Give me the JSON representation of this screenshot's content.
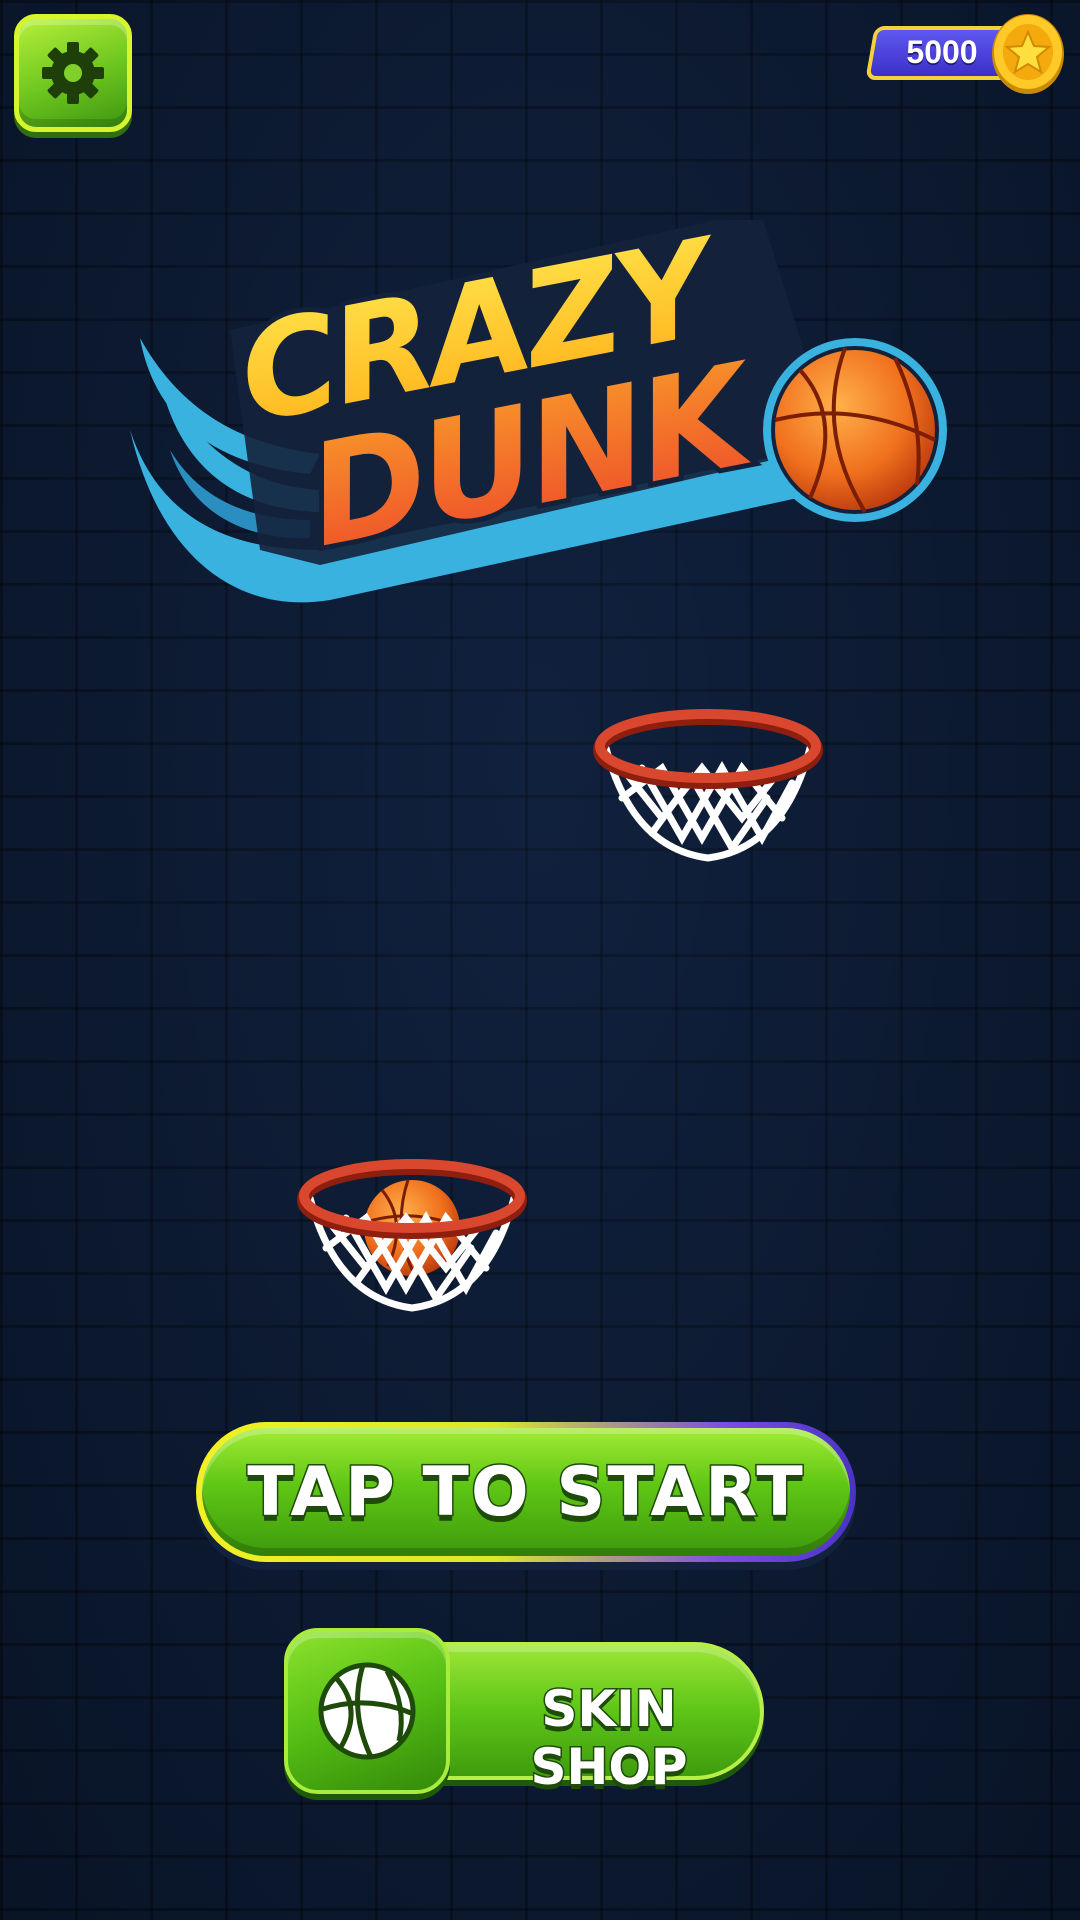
{
  "top_bar": {
    "settings_icon": "gear-icon",
    "coins": "5000",
    "coin_icon": "star-coin-icon"
  },
  "logo": {
    "line1": "CRAZY",
    "line2": "DUNK"
  },
  "buttons": {
    "start_label": "TAP TO START",
    "shop_label": "SKIN SHOP",
    "shop_icon": "basketball-icon"
  },
  "colors": {
    "background": "#0c1a33",
    "button_green": "#5fc615",
    "coin_purple": "#3c2fc9",
    "gold": "#f3d13a",
    "logo_yellow": "#ffd21f",
    "logo_orange": "#f2622a",
    "swoosh_blue": "#39b2e0",
    "rim_red": "#d0432a"
  }
}
